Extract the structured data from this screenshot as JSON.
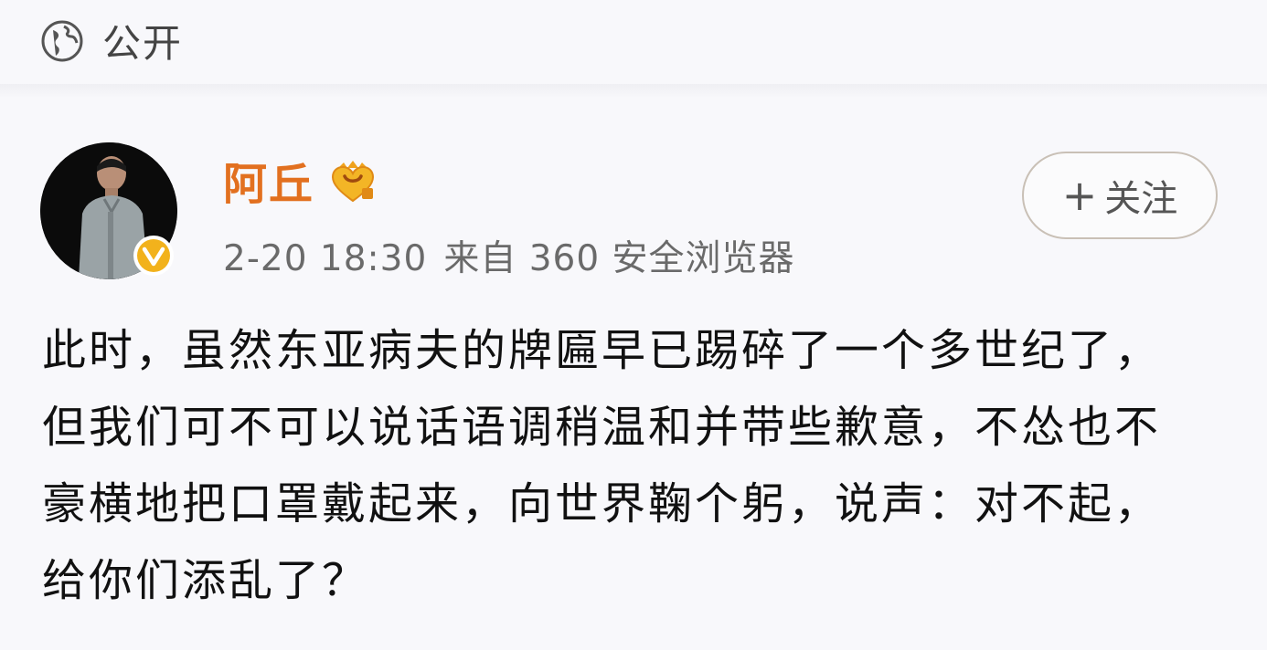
{
  "header": {
    "visibility_icon": "globe-icon",
    "visibility_label": "公开"
  },
  "post": {
    "author": {
      "name": "阿丘",
      "name_color": "#e2701f",
      "vip_icon": "crown-heart-icon",
      "verified_icon": "verified-v-badge-icon",
      "verified_color": "#f2b21c"
    },
    "time": "2-20 18:30",
    "source": "来自 360 安全浏览器",
    "follow_button": {
      "icon": "plus-icon",
      "label": "关注"
    },
    "text": "此时，虽然东亚病夫的牌匾早已踢碎了一个多世纪了，但我们可不可以说话语调稍温和并带些歉意，不怂也不豪横地把口罩戴起来，向世界鞠个躬，说声：对不起，给你们添乱了？"
  }
}
